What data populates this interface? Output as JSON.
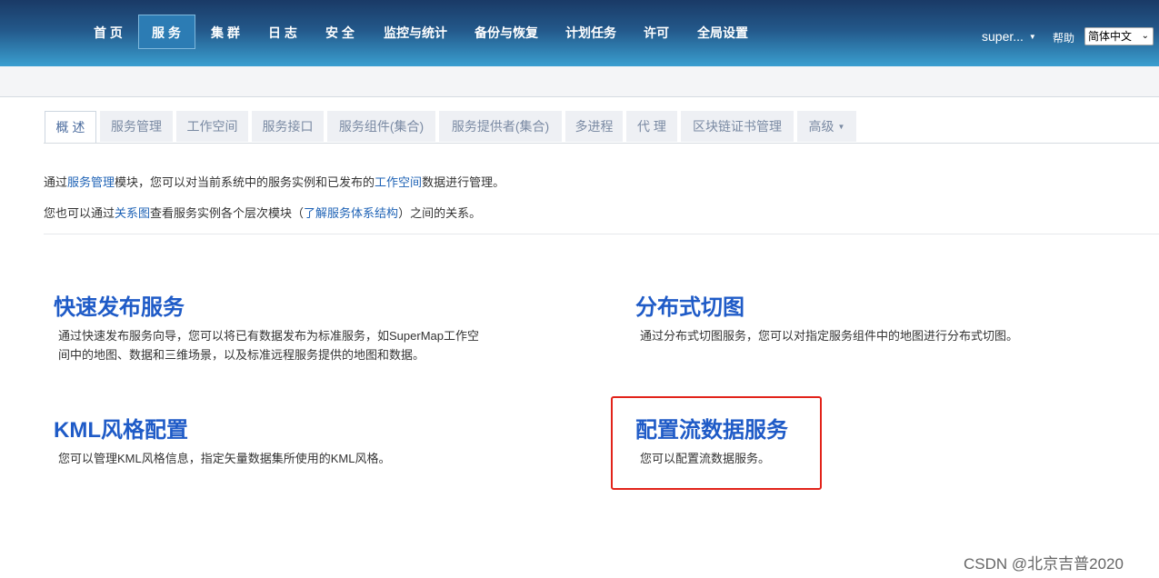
{
  "nav": {
    "items": [
      {
        "label": "首 页"
      },
      {
        "label": "服 务"
      },
      {
        "label": "集 群"
      },
      {
        "label": "日 志"
      },
      {
        "label": "安 全"
      },
      {
        "label": "监控与统计"
      },
      {
        "label": "备份与恢复"
      },
      {
        "label": "计划任务"
      },
      {
        "label": "许可"
      },
      {
        "label": "全局设置"
      }
    ],
    "active_index": 1,
    "user": "super...",
    "help": "帮助",
    "language": "简体中文"
  },
  "tabs": [
    {
      "label": "概 述"
    },
    {
      "label": "服务管理"
    },
    {
      "label": "工作空间"
    },
    {
      "label": "服务接口"
    },
    {
      "label": "服务组件(集合)"
    },
    {
      "label": "服务提供者(集合)"
    },
    {
      "label": "多进程"
    },
    {
      "label": "代 理"
    },
    {
      "label": "区块链证书管理"
    },
    {
      "label": "高级"
    }
  ],
  "intro": {
    "line1": {
      "p1": "通过",
      "link1": "服务管理",
      "p2": "模块，您可以对当前系统中的服务实例和已发布的",
      "link2": "工作空间",
      "p3": "数据进行管理。"
    },
    "line2": {
      "p1": "您也可以通过",
      "link1": "关系图",
      "p2": "查看服务实例各个层次模块（",
      "link2": "了解服务体系结构",
      "p3": "）之间的关系。"
    }
  },
  "cards": [
    {
      "title": "快速发布服务",
      "desc_line1": "通过快速发布服务向导，您可以将已有数据发布为标准服务，如SuperMap工作空",
      "desc_line2": "间中的地图、数据和三维场景，以及标准远程服务提供的地图和数据。"
    },
    {
      "title": "分布式切图",
      "desc_line1": "通过分布式切图服务，您可以对指定服务组件中的地图进行分布式切图。"
    },
    {
      "title": "KML风格配置",
      "desc_line1": "您可以管理KML风格信息，指定矢量数据集所使用的KML风格。"
    },
    {
      "title": "配置流数据服务",
      "desc_line1": "您可以配置流数据服务。"
    }
  ],
  "highlight_color": "#e2231a",
  "watermark": "CSDN @北京吉普2020"
}
